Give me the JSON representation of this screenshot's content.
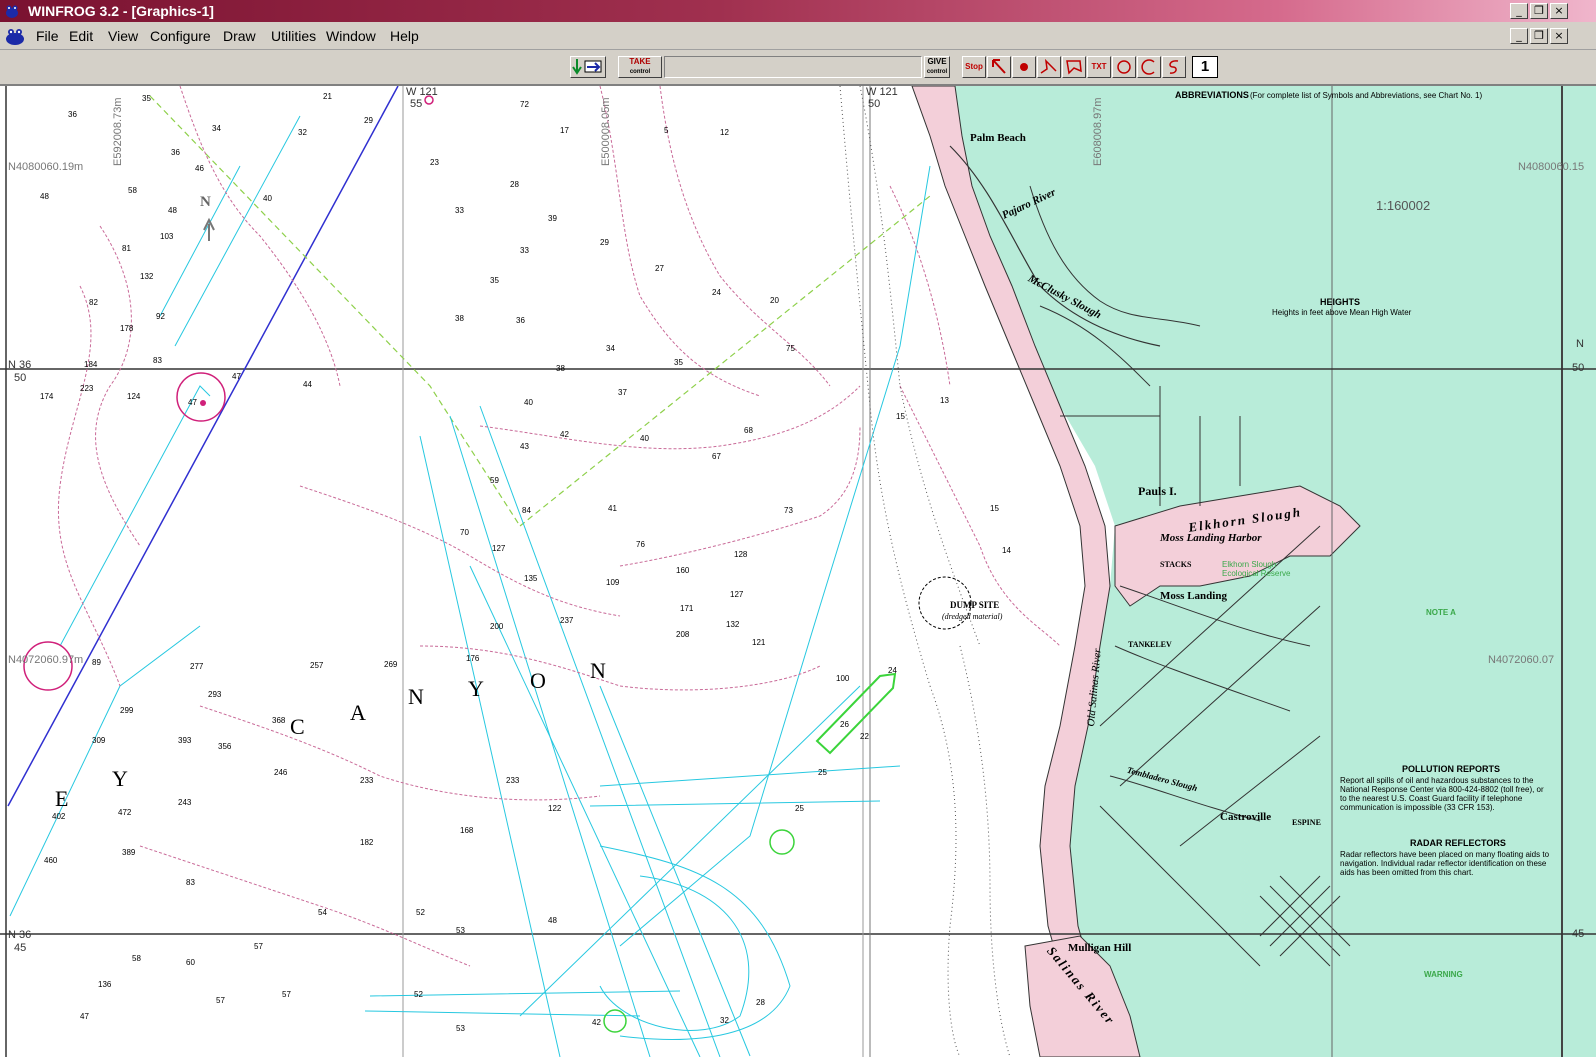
{
  "app": {
    "title": "WINFROG 3.2 - [Graphics-1]"
  },
  "menu": [
    "File",
    "Edit",
    "View",
    "Configure",
    "Draw",
    "Utilities",
    "Window",
    "Help"
  ],
  "toolbar": {
    "take_label": "TAKE",
    "take_sub": "control",
    "give_label": "GIVE",
    "give_sub": "control",
    "stop_label": "Stop",
    "txt_label": "TXT",
    "page_number": "1"
  },
  "map": {
    "coord_labels": {
      "n_top_left": "N4080060.19m",
      "n_top_right": "N4080060.15",
      "n_mid_left": "N4072060.97m",
      "n_mid_right": "N4072060.07",
      "e_left": "E592008.73m",
      "e_mid": "E500008.05m",
      "e_right": "E608008.97m",
      "w121_a": "W 121",
      "w121_a_min": "55",
      "w121_b": "W 121",
      "w121_b_min": "50",
      "n36_a": "N 36",
      "n36_a_min": "50",
      "n36_b": "N 36",
      "n36_b_min": "45",
      "n_right_a": "N",
      "n_right_a_min": "50",
      "n_right_b": "45"
    },
    "north_label": "N",
    "canyon_letters": [
      "E",
      "Y",
      "C",
      "A",
      "N",
      "Y",
      "O",
      "N"
    ],
    "places": {
      "palm_beach": "Palm Beach",
      "pajaro_river": "Pajaro River",
      "mcclusky_slough": "McClusky Slough",
      "pauls_island": "Pauls I.",
      "elkhorn_slough": "Elkhorn Slough",
      "moss_landing_harbor": "Moss Landing Harbor",
      "moss_landing": "Moss Landing",
      "stacks": "STACKS",
      "dump_site": "DUMP SITE",
      "dump_site_sub": "(dredged material)",
      "old_salinas_river": "Old Salinas River",
      "tembladero_slough": "Tembladero Slough",
      "castroville": "Castroville",
      "mulligan_hill": "Mulligan Hill",
      "salinas_river": "Salinas River",
      "espine": "ESPINE",
      "tank": "TANK",
      "tank_elev": "ELEV"
    },
    "scale": "1:160002",
    "abbrev_title": "ABBREVIATIONS",
    "abbrev_sub": "(For complete list of Symbols and Abbreviations, see Chart No. 1)",
    "heights_title": "HEIGHTS",
    "heights_text": "Heights in feet above Mean High Water",
    "note_a_title": "NOTE A",
    "pollution_title": "POLLUTION REPORTS",
    "pollution_text": "Report all spills of oil and hazardous substances to the National Response Center via 800-424-8802 (toll free), or to the nearest U.S. Coast Guard facility if telephone communication is impossible (33 CFR 153).",
    "radar_title": "RADAR REFLECTORS",
    "radar_text": "Radar reflectors have been placed on many floating aids to navigation. Individual radar reflector identification on these aids has been omitted from this chart.",
    "warning_title": "WARNING",
    "reserve_text": "Elkhorn Slough Ecological Reserve"
  }
}
